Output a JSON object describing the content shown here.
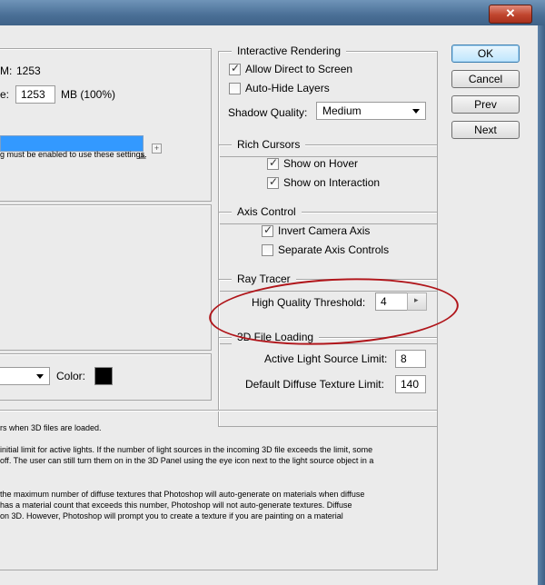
{
  "window": {
    "close_glyph": "✕"
  },
  "memory": {
    "available_label": "M:",
    "available_value": "1253",
    "use_label": "e:",
    "use_value": "1253",
    "use_unit": "MB (100%)",
    "note": "g must be enabled to use these settings.",
    "usage_fill_percent": 100
  },
  "interactive_rendering": {
    "title": "Interactive Rendering",
    "allow_direct": {
      "label": "Allow Direct to Screen",
      "checked": true
    },
    "auto_hide": {
      "label": "Auto-Hide Layers",
      "checked": false
    },
    "shadow_quality_label": "Shadow Quality:",
    "shadow_quality_value": "Medium"
  },
  "rich_cursors": {
    "title": "Rich Cursors",
    "show_on_hover": {
      "label": "Show on Hover",
      "checked": true
    },
    "show_on_interaction": {
      "label": "Show on Interaction",
      "checked": true
    }
  },
  "axis_control": {
    "title": "Axis Control",
    "invert_camera": {
      "label": "Invert Camera Axis",
      "checked": true
    },
    "separate_axis": {
      "label": "Separate Axis Controls",
      "checked": false
    }
  },
  "ray_tracer": {
    "title": "Ray Tracer",
    "hq_label": "High Quality Threshold:",
    "hq_value": "4"
  },
  "file_loading": {
    "title": "3D File Loading",
    "light_limit_label": "Active Light Source Limit:",
    "light_limit_value": "8",
    "texture_limit_label": "Default Diffuse Texture Limit:",
    "texture_limit_value": "140"
  },
  "color_row": {
    "color_label": "Color:",
    "color_value": "#000000"
  },
  "description": {
    "line1": "rs when 3D files are loaded.",
    "line2": "initial limit for active lights. If the number of light sources in the incoming 3D file exceeds the limit, some",
    "line3": "off. The user can still turn them on in the 3D Panel using the eye icon next to the light source object in a",
    "line4": "the maximum number of diffuse textures that Photoshop will auto-generate on materials when diffuse",
    "line5": "has a material count that exceeds this number, Photoshop will not auto-generate textures. Diffuse",
    "line6": "on 3D.  However, Photoshop will prompt you to create a texture if you are painting on a material"
  },
  "buttons": {
    "ok": "OK",
    "cancel": "Cancel",
    "prev": "Prev",
    "next": "Next"
  },
  "colors": {
    "annotation_ring": "#b0151a",
    "bar": "#3399ff"
  }
}
